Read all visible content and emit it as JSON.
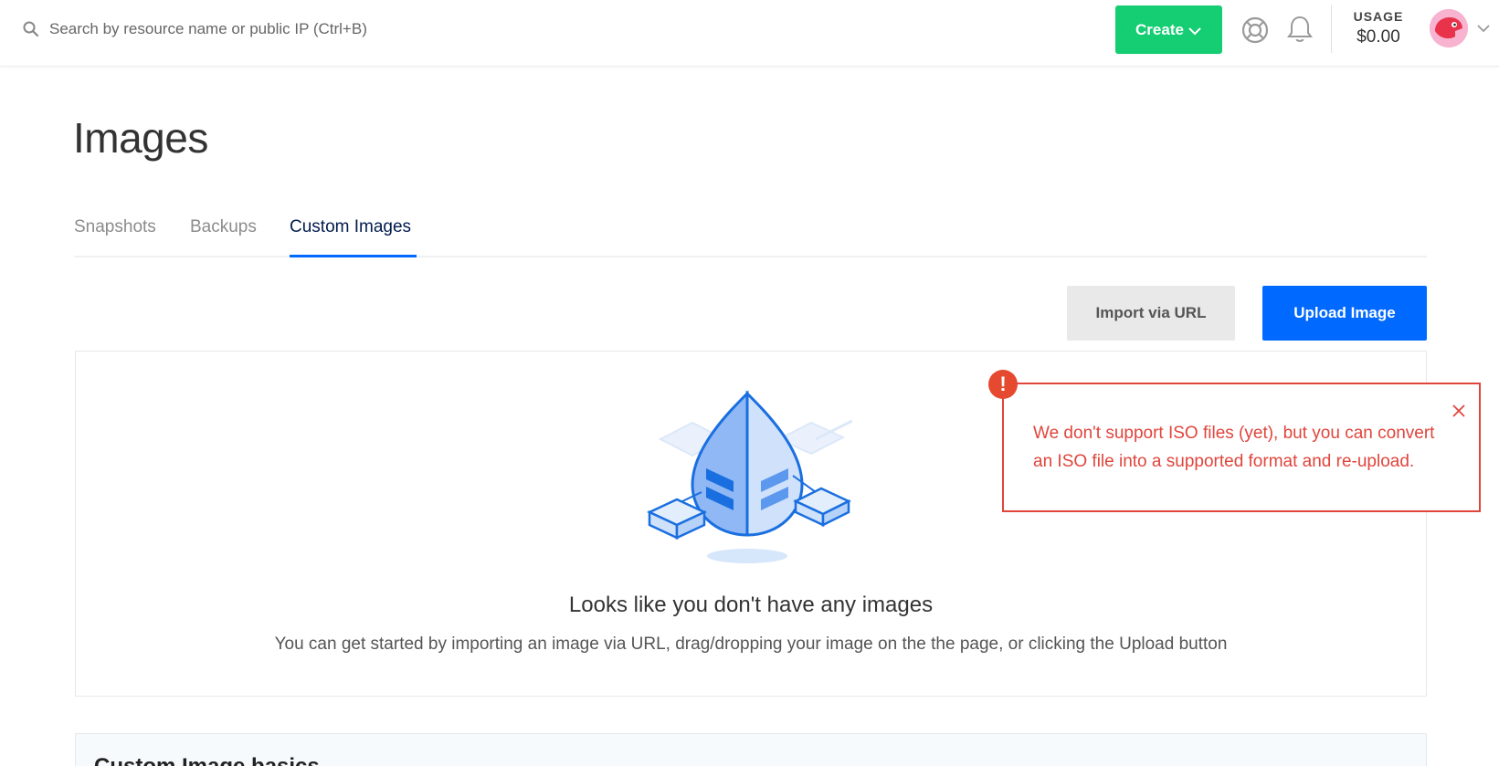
{
  "header": {
    "search_placeholder": "Search by resource name or public IP (Ctrl+B)",
    "create_label": "Create",
    "usage_label": "USAGE",
    "usage_value": "$0.00",
    "icons": [
      "search-icon",
      "help-lifebuoy-icon",
      "bell-icon",
      "chevron-down-icon"
    ]
  },
  "page": {
    "title": "Images",
    "tabs": [
      {
        "label": "Snapshots",
        "active": false
      },
      {
        "label": "Backups",
        "active": false
      },
      {
        "label": "Custom Images",
        "active": true
      }
    ],
    "actions": {
      "import_label": "Import via URL",
      "upload_label": "Upload Image"
    },
    "empty_state": {
      "title": "Looks like you don't have any images",
      "description": "You can get started by importing an image via URL, drag/dropping your image on the the page, or clicking the Upload button"
    },
    "basics_title": "Custom Image basics"
  },
  "toast": {
    "badge": "!",
    "message": "We don't support ISO files (yet), but you can convert an ISO file into a supported format and re-upload."
  },
  "colors": {
    "create_green": "#15cd72",
    "primary_blue": "#0069ff",
    "error_red": "#e0453c",
    "title_navy": "#031b4e"
  }
}
